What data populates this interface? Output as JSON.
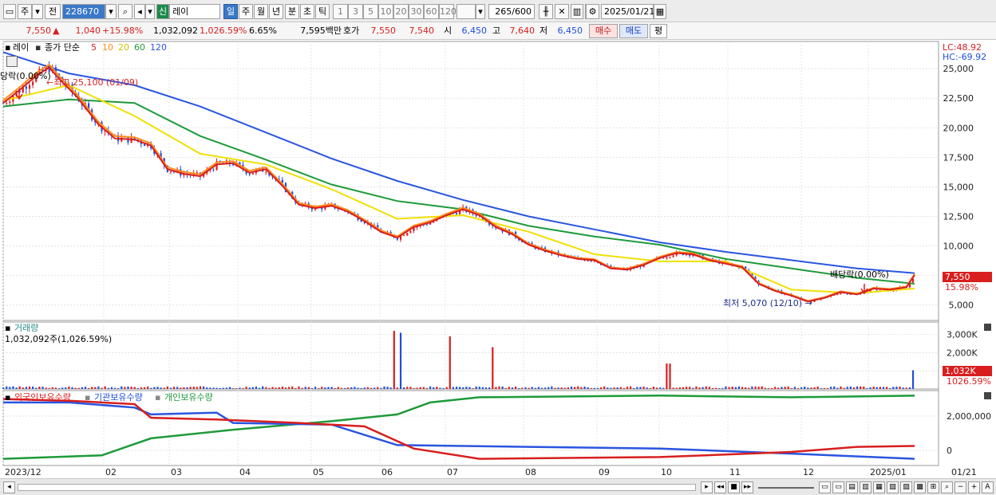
{
  "toolbar": {
    "market": "주",
    "prev": "전",
    "code": "228670",
    "name_badge": "신",
    "name": "레이",
    "periods": [
      "일",
      "주",
      "월",
      "년",
      "분",
      "초",
      "틱"
    ],
    "intervals": [
      "1",
      "3",
      "5",
      "10",
      "20",
      "30",
      "60",
      "120"
    ],
    "count": "265",
    "count_max": "/600",
    "date": "2025/01/21"
  },
  "quote": {
    "price": "7,550",
    "change_arrow": "▲",
    "change": "1,040",
    "change_pct": "+15.98%",
    "volume": "1,032,092",
    "volume_pct": "1,026.59%",
    "turnover": "6.65%",
    "amount": "7,595백만",
    "hoga_label": "호가",
    "ask": "7,550",
    "bid": "7,540",
    "open_label": "시",
    "open": "6,450",
    "high_label": "고",
    "high": "7,640",
    "low_label": "저",
    "low": "6,450",
    "buy_button": "매수",
    "sell_button": "매도",
    "eval_button": "평"
  },
  "price_panel": {
    "symbol": "레이",
    "ma_label": "종가 단순",
    "ma_periods": [
      "5",
      "10",
      "20",
      "60",
      "120"
    ],
    "lc": "LC:48.92",
    "hc": "HC:-69.92",
    "current_price": "7,550",
    "current_pct": "15.98%",
    "annotation_high": "←최고 25,100 (01/09)",
    "annotation_low": "최저 5,070 (12/10) →",
    "annotation_div_left": "당락(0.00%)",
    "annotation_div_right": "배당락(0.00%)"
  },
  "volume_panel": {
    "title": "거래량",
    "value": "1,032,092주(1,026.59%)",
    "current": "1,032K",
    "current_pct": "1026.59%"
  },
  "holding_panel": {
    "foreign": "외국인보유수량",
    "institution": "기관보유수량",
    "individual": "개인보유수량"
  },
  "colors": {
    "ma5": "#d81e1e",
    "ma10": "#ff8c1a",
    "ma20": "#f0e000",
    "ma60": "#1e9a3a",
    "ma120": "#2a55e0",
    "up": "#d81e1e",
    "down": "#1e4fd8"
  },
  "chart_data": {
    "type": "line",
    "x_ticks": [
      "2023/12",
      "02",
      "03",
      "04",
      "05",
      "06",
      "07",
      "08",
      "09",
      "10",
      "11",
      "12",
      "2025/01",
      "01/21"
    ],
    "price_ticks": [
      "25,000",
      "22,500",
      "20,000",
      "17,500",
      "15,000",
      "12,500",
      "10,000",
      "7,500",
      "5,000"
    ],
    "price_ylim": [
      3700,
      26900
    ],
    "volume_ticks": [
      "3,000K",
      "2,000K",
      "1,000K"
    ],
    "holding_ticks": [
      "2,000,000",
      "0"
    ],
    "close_path": [
      [
        0,
        22100
      ],
      [
        10,
        23200
      ],
      [
        20,
        24400
      ],
      [
        28,
        25100
      ],
      [
        35,
        24000
      ],
      [
        45,
        22600
      ],
      [
        58,
        20300
      ],
      [
        68,
        19100
      ],
      [
        80,
        19000
      ],
      [
        90,
        18500
      ],
      [
        100,
        16500
      ],
      [
        110,
        16100
      ],
      [
        120,
        15900
      ],
      [
        130,
        16900
      ],
      [
        140,
        17000
      ],
      [
        150,
        16200
      ],
      [
        160,
        16500
      ],
      [
        170,
        15100
      ],
      [
        180,
        13500
      ],
      [
        190,
        13200
      ],
      [
        200,
        13400
      ],
      [
        210,
        12900
      ],
      [
        220,
        12100
      ],
      [
        230,
        11200
      ],
      [
        240,
        10700
      ],
      [
        250,
        11600
      ],
      [
        260,
        12000
      ],
      [
        270,
        12600
      ],
      [
        280,
        13100
      ],
      [
        290,
        12600
      ],
      [
        300,
        11600
      ],
      [
        310,
        11000
      ],
      [
        320,
        10100
      ],
      [
        330,
        9600
      ],
      [
        340,
        9200
      ],
      [
        350,
        8900
      ],
      [
        360,
        8800
      ],
      [
        370,
        8100
      ],
      [
        380,
        8000
      ],
      [
        390,
        8400
      ],
      [
        400,
        9000
      ],
      [
        410,
        9400
      ],
      [
        420,
        9300
      ],
      [
        430,
        8800
      ],
      [
        440,
        8500
      ],
      [
        450,
        8200
      ],
      [
        460,
        6800
      ],
      [
        470,
        6200
      ],
      [
        480,
        5800
      ],
      [
        490,
        5300
      ],
      [
        500,
        5600
      ],
      [
        510,
        6100
      ],
      [
        520,
        5900
      ],
      [
        530,
        6400
      ],
      [
        540,
        6300
      ],
      [
        550,
        6500
      ],
      [
        555,
        7550
      ]
    ],
    "ma20_path": [
      [
        0,
        22300
      ],
      [
        40,
        23600
      ],
      [
        80,
        21000
      ],
      [
        120,
        17800
      ],
      [
        160,
        16900
      ],
      [
        200,
        14800
      ],
      [
        240,
        12300
      ],
      [
        280,
        12600
      ],
      [
        320,
        11200
      ],
      [
        360,
        9300
      ],
      [
        400,
        8700
      ],
      [
        440,
        8700
      ],
      [
        480,
        6300
      ],
      [
        520,
        6000
      ],
      [
        555,
        6400
      ]
    ],
    "ma60_path": [
      [
        0,
        21800
      ],
      [
        40,
        22400
      ],
      [
        80,
        22100
      ],
      [
        120,
        19300
      ],
      [
        160,
        17300
      ],
      [
        200,
        15200
      ],
      [
        240,
        13800
      ],
      [
        280,
        13100
      ],
      [
        320,
        11700
      ],
      [
        360,
        10800
      ],
      [
        400,
        10100
      ],
      [
        440,
        8900
      ],
      [
        480,
        8100
      ],
      [
        520,
        7300
      ],
      [
        555,
        6800
      ]
    ],
    "ma120_path": [
      [
        0,
        26400
      ],
      [
        40,
        24600
      ],
      [
        80,
        23600
      ],
      [
        120,
        21800
      ],
      [
        160,
        19600
      ],
      [
        200,
        17400
      ],
      [
        240,
        15500
      ],
      [
        280,
        13900
      ],
      [
        320,
        12500
      ],
      [
        360,
        11400
      ],
      [
        400,
        10300
      ],
      [
        440,
        9500
      ],
      [
        480,
        8800
      ],
      [
        520,
        8100
      ],
      [
        555,
        7700
      ]
    ],
    "volume_spikes_K": [
      [
        238,
        3200
      ],
      [
        242,
        3100
      ],
      [
        272,
        2900
      ],
      [
        298,
        2300
      ],
      [
        405,
        1400
      ],
      [
        555,
        1032
      ]
    ],
    "foreign_path": [
      [
        0,
        3000000
      ],
      [
        40,
        2900000
      ],
      [
        80,
        2700000
      ],
      [
        90,
        1900000
      ],
      [
        130,
        1800000
      ],
      [
        180,
        1600000
      ],
      [
        220,
        1400000
      ],
      [
        250,
        100000
      ],
      [
        290,
        -500000
      ],
      [
        400,
        -400000
      ],
      [
        480,
        -100000
      ],
      [
        520,
        200000
      ],
      [
        555,
        250000
      ]
    ],
    "institution_path": [
      [
        0,
        2800000
      ],
      [
        40,
        2800000
      ],
      [
        80,
        2500000
      ],
      [
        90,
        2100000
      ],
      [
        130,
        2200000
      ],
      [
        140,
        1600000
      ],
      [
        200,
        1500000
      ],
      [
        240,
        300000
      ],
      [
        320,
        200000
      ],
      [
        400,
        100000
      ],
      [
        480,
        -200000
      ],
      [
        555,
        -500000
      ]
    ],
    "individual_path": [
      [
        0,
        -500000
      ],
      [
        60,
        -300000
      ],
      [
        90,
        700000
      ],
      [
        140,
        1200000
      ],
      [
        200,
        1700000
      ],
      [
        240,
        2100000
      ],
      [
        260,
        2800000
      ],
      [
        290,
        3100000
      ],
      [
        400,
        3200000
      ],
      [
        480,
        3100000
      ],
      [
        555,
        3200000
      ]
    ],
    "n_bars": 556
  }
}
